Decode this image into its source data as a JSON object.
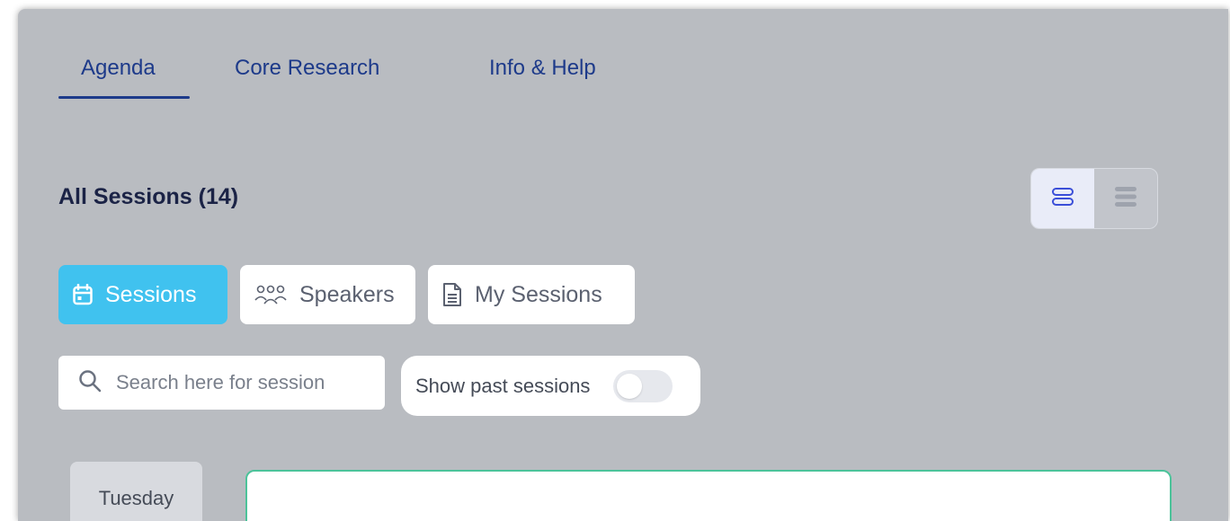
{
  "tabs": [
    {
      "label": "Agenda",
      "active": true
    },
    {
      "label": "Core Research",
      "active": false
    },
    {
      "label": "Info & Help",
      "active": false
    }
  ],
  "page_title": "All Sessions (14)",
  "view_toggle": {
    "active": "expanded-list",
    "icons": [
      "expanded-list-icon",
      "compact-list-icon"
    ]
  },
  "filters": [
    {
      "label": "Sessions",
      "icon": "calendar-icon",
      "active": true
    },
    {
      "label": "Speakers",
      "icon": "people-icon",
      "active": false
    },
    {
      "label": "My Sessions",
      "icon": "document-icon",
      "active": false
    }
  ],
  "search": {
    "placeholder": "Search here for session",
    "value": ""
  },
  "past_toggle": {
    "label": "Show past sessions",
    "on": false
  },
  "day": {
    "label": "Tuesday"
  },
  "colors": {
    "accent": "#40c2ef",
    "tab_text": "#1d3a8a",
    "card_border": "#4cc39a",
    "panel_bg": "#b9bcc1"
  }
}
